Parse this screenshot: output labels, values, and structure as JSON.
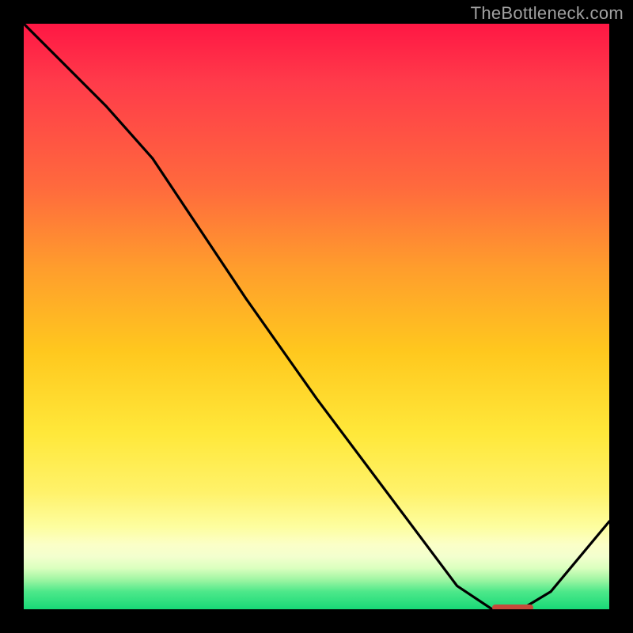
{
  "watermark": "TheBottleneck.com",
  "chart_data": {
    "type": "line",
    "title": "",
    "xlabel": "",
    "ylabel": "",
    "xlim": [
      0,
      100
    ],
    "ylim": [
      0,
      100
    ],
    "grid": false,
    "series": [
      {
        "name": "bottleneck-curve",
        "x": [
          0,
          6,
          14,
          22,
          28,
          38,
          50,
          62,
          74,
          80,
          85,
          90,
          100
        ],
        "values": [
          100,
          94,
          86,
          77,
          68,
          53,
          36,
          20,
          4,
          0,
          0,
          3,
          15
        ]
      }
    ],
    "background_gradient": {
      "stops": [
        {
          "pct": 0,
          "hex": "#ff1744"
        },
        {
          "pct": 10,
          "hex": "#ff3b4a"
        },
        {
          "pct": 28,
          "hex": "#ff6a3d"
        },
        {
          "pct": 42,
          "hex": "#ff9e2c"
        },
        {
          "pct": 56,
          "hex": "#ffc81e"
        },
        {
          "pct": 70,
          "hex": "#ffe83a"
        },
        {
          "pct": 80,
          "hex": "#fff26a"
        },
        {
          "pct": 86,
          "hex": "#fdfea0"
        },
        {
          "pct": 89,
          "hex": "#fbffc8"
        },
        {
          "pct": 91,
          "hex": "#f3ffce"
        },
        {
          "pct": 93,
          "hex": "#daffbe"
        },
        {
          "pct": 95,
          "hex": "#9df5a2"
        },
        {
          "pct": 97,
          "hex": "#4de88a"
        },
        {
          "pct": 100,
          "hex": "#18d977"
        }
      ]
    },
    "minimum_marker": {
      "x_start": 80,
      "x_end": 87,
      "y": 0,
      "hex": "#c54a3a"
    }
  }
}
